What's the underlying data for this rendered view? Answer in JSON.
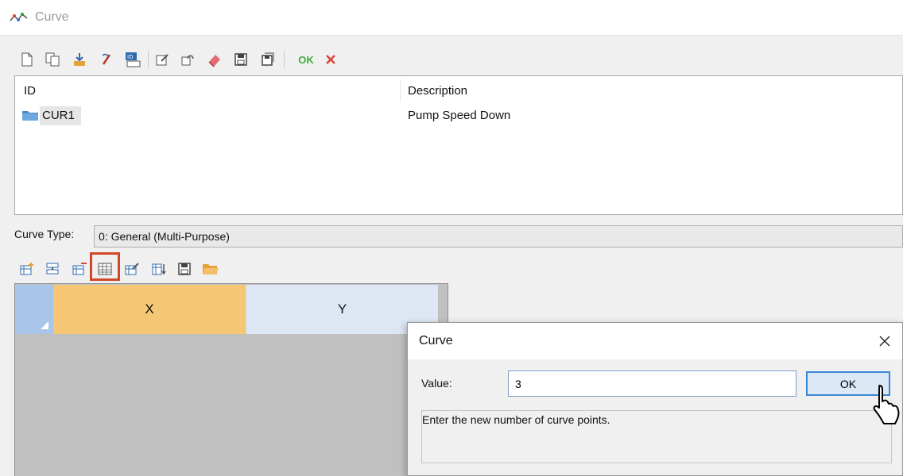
{
  "window": {
    "title": "Curve",
    "icon": "curve-chart-icon"
  },
  "main_toolbar": {
    "buttons": [
      {
        "icon": "new-document-icon"
      },
      {
        "icon": "copy-icon"
      },
      {
        "icon": "import-icon"
      },
      {
        "icon": "edit-link-icon"
      },
      {
        "icon": "id-table-icon"
      },
      {
        "icon": "edit-icon"
      },
      {
        "icon": "edit-group-icon"
      },
      {
        "icon": "eraser-icon"
      },
      {
        "icon": "save-icon"
      },
      {
        "icon": "save-all-icon"
      }
    ],
    "ok_label": "OK",
    "cancel_icon": "cancel-x-icon"
  },
  "list": {
    "columns": [
      "ID",
      "Description"
    ],
    "rows": [
      {
        "id": "CUR1",
        "description": "Pump Speed Down",
        "icon": "folder-icon"
      }
    ]
  },
  "curve_type": {
    "label": "Curve Type:",
    "value": "0: General (Multi-Purpose)"
  },
  "grid_toolbar": {
    "buttons": [
      {
        "icon": "add-row-icon"
      },
      {
        "icon": "insert-row-icon"
      },
      {
        "icon": "delete-row-icon"
      },
      {
        "icon": "set-rows-icon",
        "highlighted": true
      },
      {
        "icon": "edit-table-icon"
      },
      {
        "icon": "sort-table-icon"
      },
      {
        "icon": "save-icon"
      },
      {
        "icon": "open-folder-icon"
      }
    ],
    "highlight_color": "#d24726"
  },
  "grid": {
    "columns": [
      "X",
      "Y"
    ],
    "selected_column_color": "#f5c774"
  },
  "dialog": {
    "title": "Curve",
    "value_label": "Value:",
    "value": "3",
    "ok_label": "OK",
    "message": "Enter the new number of curve points.",
    "close_icon": "close-icon"
  }
}
